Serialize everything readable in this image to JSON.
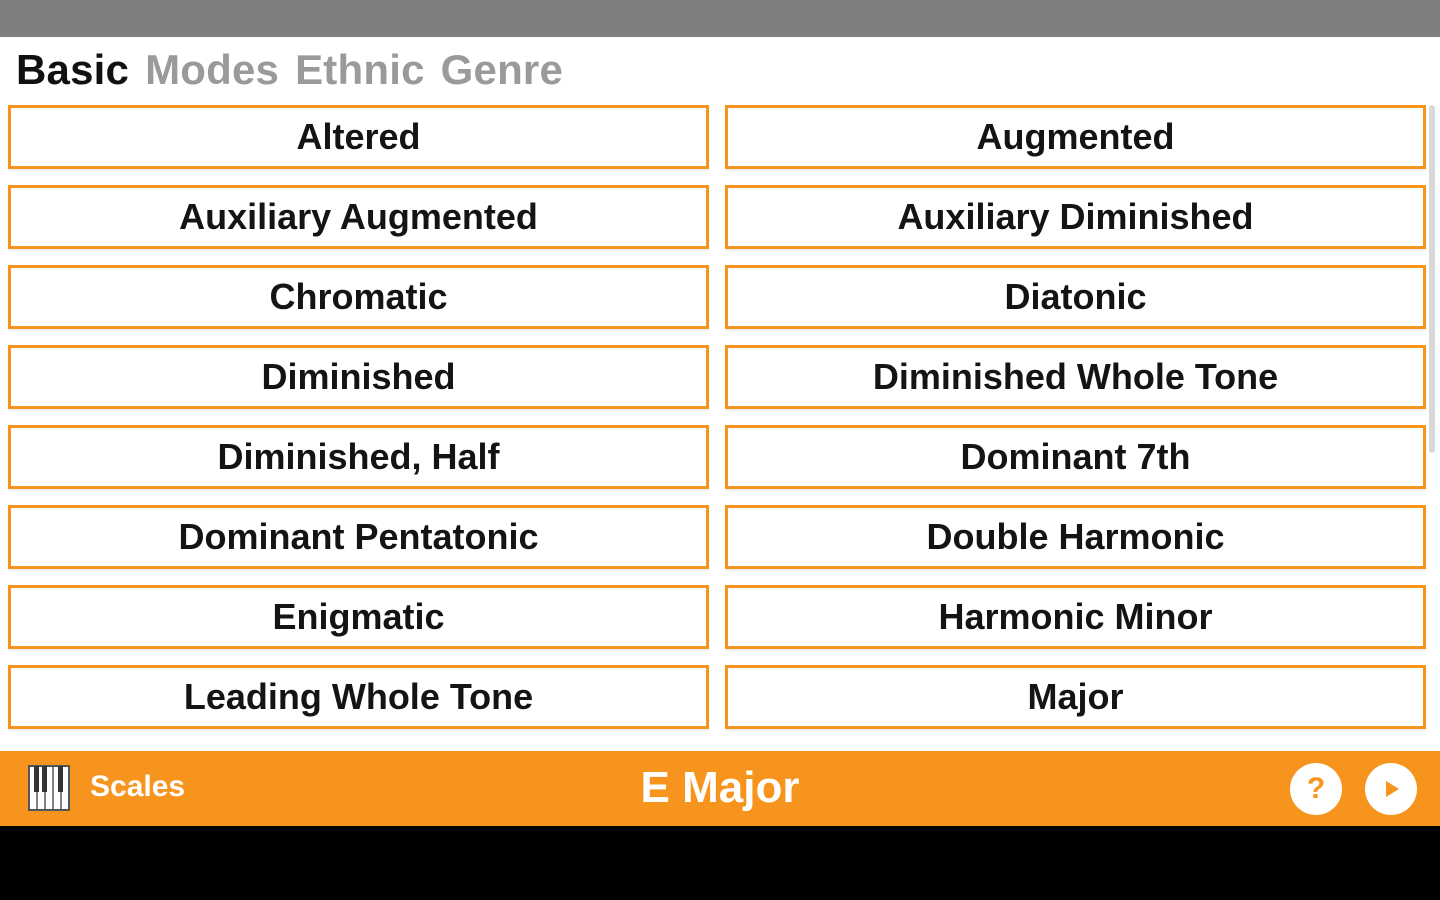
{
  "tabs": [
    {
      "label": "Basic",
      "active": true
    },
    {
      "label": "Modes",
      "active": false
    },
    {
      "label": "Ethnic",
      "active": false
    },
    {
      "label": "Genre",
      "active": false
    }
  ],
  "scales": [
    "Altered",
    "Augmented",
    "Auxiliary Augmented",
    "Auxiliary Diminished",
    "Chromatic",
    "Diatonic",
    "Diminished",
    "Diminished Whole Tone",
    "Diminished, Half",
    "Dominant 7th",
    "Dominant Pentatonic",
    "Double Harmonic",
    "Enigmatic",
    "Harmonic Minor",
    "Leading Whole Tone",
    "Major"
  ],
  "bottom_bar": {
    "section_label": "Scales",
    "current_scale": "E Major",
    "help_icon": "question-mark-icon",
    "play_icon": "play-icon",
    "piano_icon": "piano-keys-icon"
  },
  "colors": {
    "accent": "#f7941d",
    "status_bar": "#7f7f7f",
    "active_tab": "#111111",
    "inactive_tab": "#9a9a9a"
  }
}
